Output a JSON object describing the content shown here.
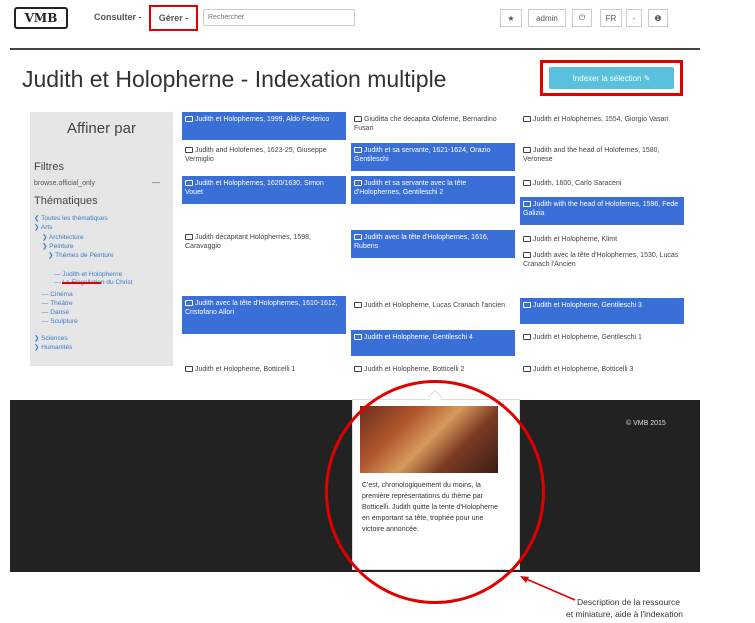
{
  "nav": {
    "logo": "VMB",
    "consulter": "Consulter -",
    "gerer": "Gérer -",
    "search_placeholder": "Rechercher",
    "star": "★",
    "user": "admin",
    "power": "⏻",
    "lang": "FR",
    "lang_caret": "-",
    "help": "❶"
  },
  "page": {
    "title": "Judith et Holopherne - Indexation multiple",
    "index_button": "Indexer la sélection ✎"
  },
  "sidebar": {
    "heading": "Affiner par",
    "filtres": "Filtres",
    "browse": "browse.official_only",
    "browse_dash": "—",
    "thematiques": "Thématiques",
    "tree": [
      "❮ Toutes les thématiques",
      "❯ Arts",
      "❯ Architecture",
      "❯ Peinture",
      "❯ Thèmes de Peinture",
      "— Judith et Holopherne",
      "— La Flagellation du Christ",
      "— Cinéma",
      "— Théâtre",
      "— Danse",
      "— Sculpture",
      "❯ Sciences",
      "❯ Humanités"
    ]
  },
  "tiles": [
    {
      "text": "Judith et Holophernes, 1999, Aldo Federico",
      "selected": true
    },
    {
      "text": "Giuditta che decapita Oloferne, Bernardino Fusari",
      "selected": false
    },
    {
      "text": "Judith et Holophernes, 1554, Giorgio Vasari",
      "selected": false
    },
    {
      "text": "Judith and Holofernes, 1623-25, Giuseppe Vermiglio",
      "selected": false
    },
    {
      "text": "Judith et sa servante, 1621-1624, Orazio Gentileschi",
      "selected": true
    },
    {
      "text": "Judith and the head of Holofernes, 1580, Veronese",
      "selected": false
    },
    {
      "text": "Judith et Holophernes, 1620/1630, Simon Vouet",
      "selected": true
    },
    {
      "text": "Judith et sa servante avec la tête d'Holophernes, Gentileschi 2",
      "selected": true
    },
    {
      "text": "Judith, 1600, Carlo Saraceni",
      "selected": false
    },
    {
      "text": "Judith with the head of Holofernes, 1596, Fede Galizia",
      "selected": true
    },
    {
      "text": "Judith décapitant Holophernes, 1598, Caravaggio",
      "selected": false
    },
    {
      "text": "Judith avec la tête d'Holophernes, 1616, Rubens",
      "selected": true
    },
    {
      "text": "Judith et Holopherne, Klimt",
      "selected": false
    },
    {
      "text": "Judith avec la tête d'Holophernes, 1530, Lucas Cranach l'Ancien",
      "selected": false
    },
    {
      "text": "Judith avec la tête d'Holophernes, 1610-1612, Cristofano Allori",
      "selected": true
    },
    {
      "text": "Judith et Holopherne, Lucas Cranach l'ancien",
      "selected": false
    },
    {
      "text": "Judith et Holopherne, Gentileschi 3",
      "selected": true
    },
    {
      "text": "Judith et Holopherne, Gentileschi 4",
      "selected": true
    },
    {
      "text": "Judith et Holopherne, Gentileschi 1",
      "selected": false
    },
    {
      "text": "Judith et Holopherne, Botticelli 1",
      "selected": false
    },
    {
      "text": "Judith et Holopherne, Botticelli 2",
      "selected": false
    },
    {
      "text": "Judith et Holopherne, Botticelli 3",
      "selected": false
    }
  ],
  "popup": {
    "text": "C'est, chronologiquement du moins, la première représentations du thème par Botticelli. Judith quitte la tente d'Holopherne en emportant sa tête, trophée pour une victoire annoncée."
  },
  "footer": {
    "copyright": "© VMB 2015"
  },
  "annotation": {
    "line1": "Description de la ressource",
    "line2": "et miniature, aide à l'indexation"
  },
  "colors": {
    "selected": "#3b6fd8",
    "accent": "#5bc0de",
    "highlight": "#e00000",
    "footer": "#222222"
  }
}
